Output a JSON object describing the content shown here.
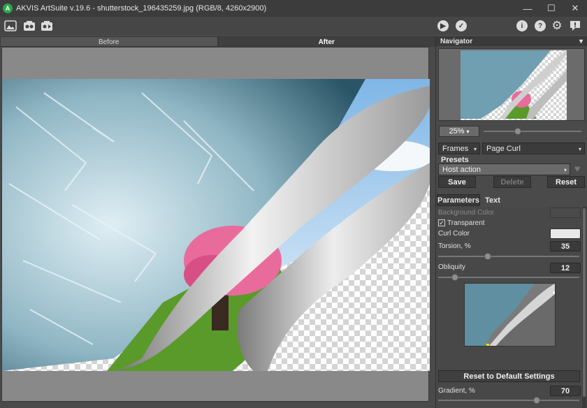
{
  "window": {
    "title": "AKVIS ArtSuite v.19.6 - shutterstock_196435259.jpg (RGB/8, 4260x2900)",
    "minimize": "—",
    "maximize": "☐",
    "close": "✕"
  },
  "toolbar": {
    "left_icons": [
      "open-image-icon",
      "batch-icon",
      "preset-icon"
    ],
    "right_icons": [
      "run-icon",
      "apply-icon",
      "info-icon",
      "help-icon",
      "settings-icon",
      "feedback-icon"
    ],
    "run": "▶",
    "apply": "✓",
    "info": "i",
    "help": "?",
    "settings": "⚙",
    "feedback": "!"
  },
  "view_tabs": {
    "before": "Before",
    "after": "After"
  },
  "navigator": {
    "title": "Navigator",
    "menu": "▾",
    "zoom": "25%",
    "zoom_arrow": "▾",
    "zoom_slider": 0.35
  },
  "effect": {
    "category": "Frames",
    "type": "Page Curl",
    "arrow": "▾"
  },
  "presets": {
    "label": "Presets",
    "selected": "Host action",
    "save": "Save",
    "delete": "Delete",
    "reset": "Reset",
    "favorite": "♥"
  },
  "param_tabs": {
    "parameters": "Parameters",
    "text": "Text"
  },
  "parameters": {
    "background_color_label": "Background Color",
    "transparent_label": "Transparent",
    "transparent_checked": "✓",
    "curl_color_label": "Curl Color",
    "curl_color": "#e8e8e8",
    "torsion_label": "Torsion, %",
    "torsion_value": "35",
    "torsion_slider": 0.35,
    "obliquity_label": "Obliquity",
    "obliquity_value": "12",
    "obliquity_slider": 0.12,
    "gradient_label": "Gradient, %",
    "gradient_value": "70",
    "gradient_slider": 0.7,
    "reset_defaults": "Reset to Default Settings"
  }
}
